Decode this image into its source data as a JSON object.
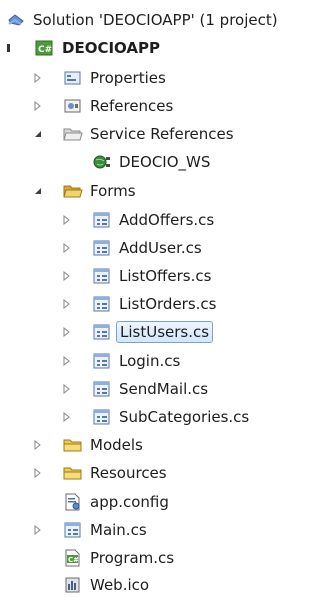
{
  "solution": {
    "label": "Solution 'DEOCIOAPP' (1 project)",
    "icon": "solution-icon"
  },
  "project": {
    "label": "DEOCIOAPP",
    "icon": "csharp-project-icon"
  },
  "nodes": {
    "properties": {
      "label": "Properties",
      "icon": "properties-icon"
    },
    "references": {
      "label": "References",
      "icon": "references-icon"
    },
    "service_references": {
      "label": "Service References",
      "icon": "folder-open-icon"
    },
    "deocio_ws": {
      "label": "DEOCIO_WS",
      "icon": "web-service-icon"
    },
    "forms": {
      "label": "Forms",
      "icon": "folder-open-icon"
    },
    "addoffers": {
      "label": "AddOffers.cs",
      "icon": "form-file-icon"
    },
    "adduser": {
      "label": "AddUser.cs",
      "icon": "form-file-icon"
    },
    "listoffers": {
      "label": "ListOffers.cs",
      "icon": "form-file-icon"
    },
    "listorders": {
      "label": "ListOrders.cs",
      "icon": "form-file-icon"
    },
    "listusers": {
      "label": "ListUsers.cs",
      "icon": "form-file-icon"
    },
    "login": {
      "label": "Login.cs",
      "icon": "form-file-icon"
    },
    "sendmail": {
      "label": "SendMail.cs",
      "icon": "form-file-icon"
    },
    "subcategories": {
      "label": "SubCategories.cs",
      "icon": "form-file-icon"
    },
    "models": {
      "label": "Models",
      "icon": "folder-icon"
    },
    "resources": {
      "label": "Resources",
      "icon": "folder-icon"
    },
    "appconfig": {
      "label": "app.config",
      "icon": "config-file-icon"
    },
    "main": {
      "label": "Main.cs",
      "icon": "form-file-icon"
    },
    "program": {
      "label": "Program.cs",
      "icon": "csharp-file-icon"
    },
    "webico": {
      "label": "Web.ico",
      "icon": "ico-file-icon"
    }
  },
  "selected_item": "ListUsers.cs",
  "colors": {
    "selection_border": "#7da2ce",
    "selection_fill": "#d3e6fb",
    "folder": "#e8c24a",
    "expander": "#8a8a8a"
  }
}
